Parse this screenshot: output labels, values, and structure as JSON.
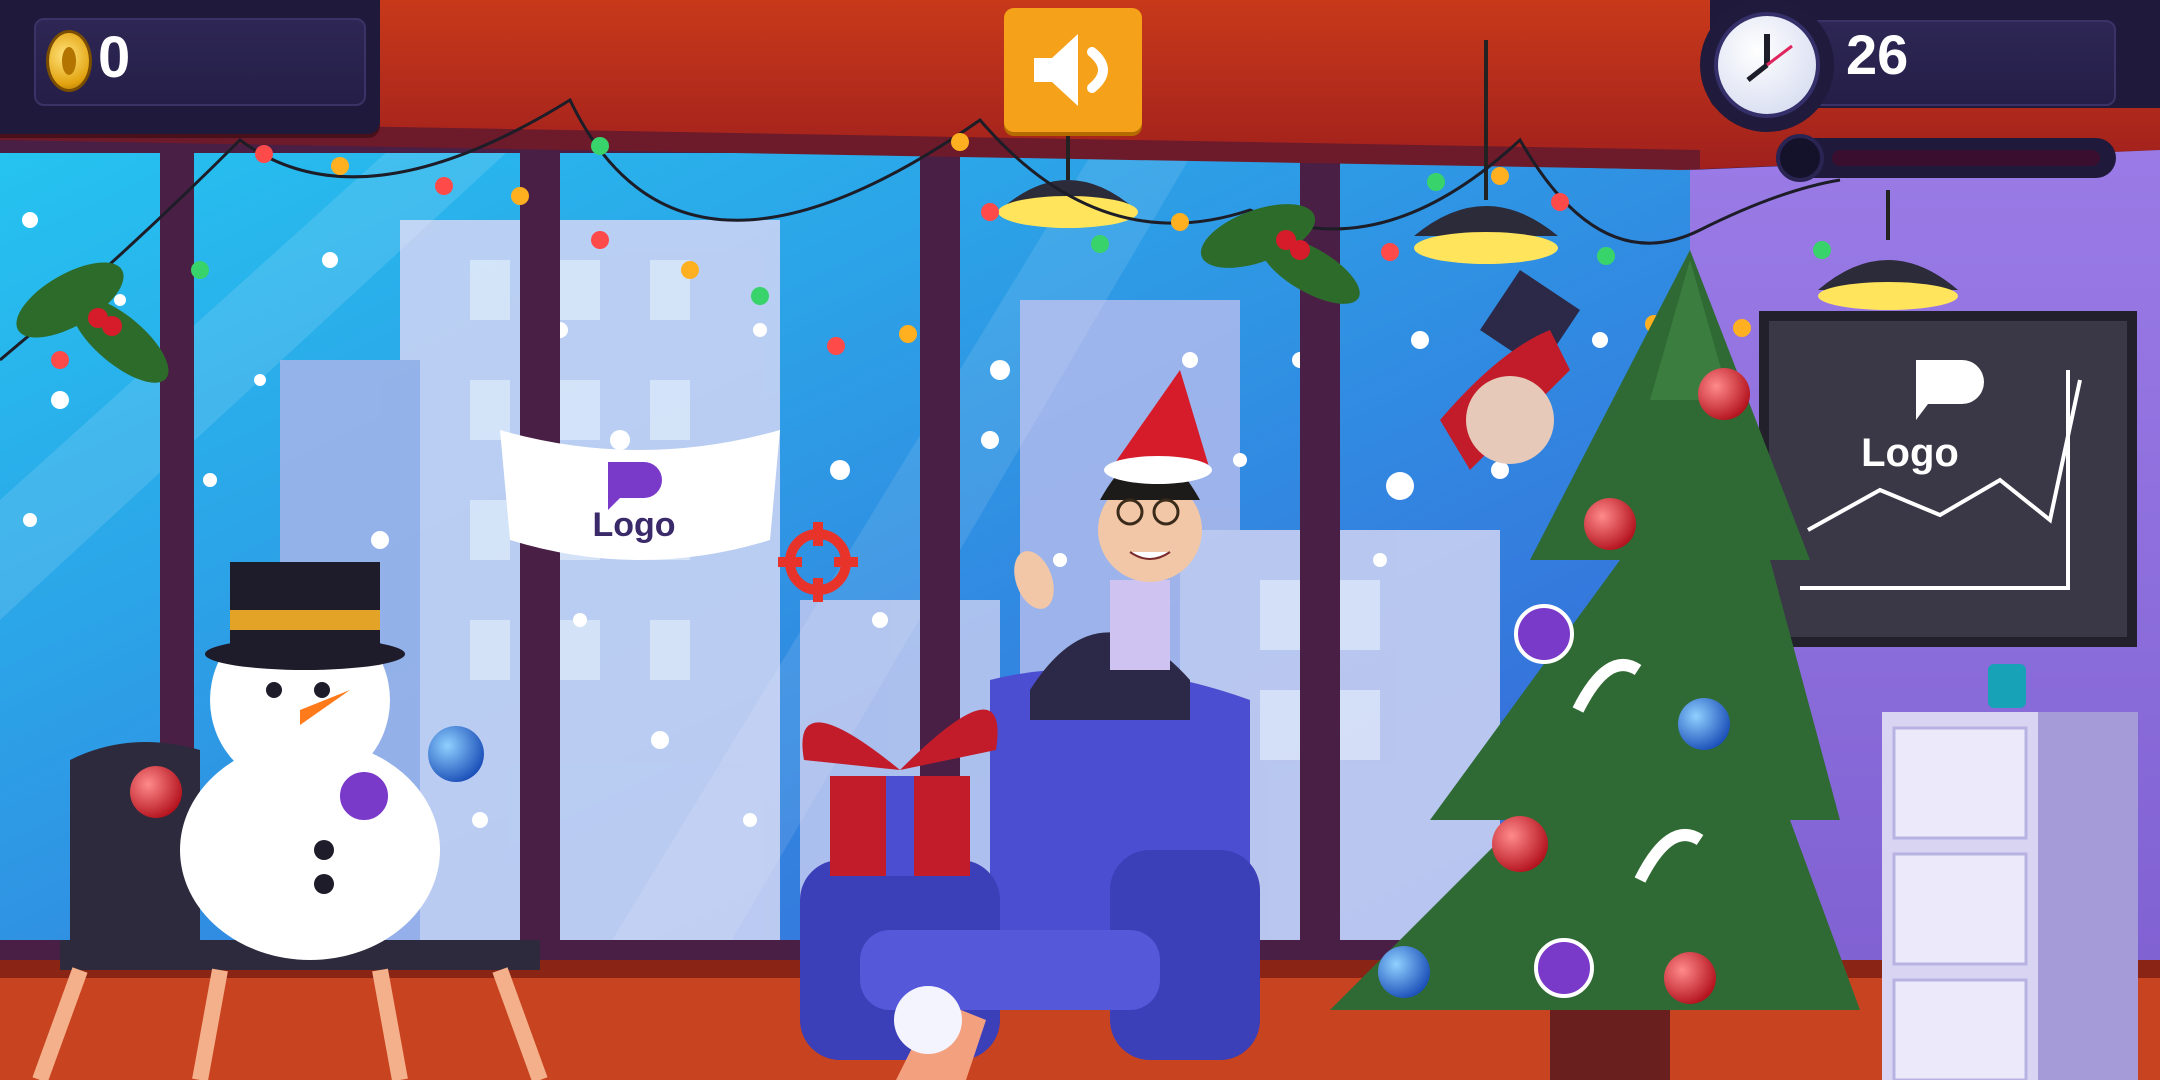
{
  "hud": {
    "coins": "0",
    "time_left": "26",
    "sound_icon": "speaker-icon",
    "timer_icon": "clock-icon",
    "coin_icon": "coin-icon",
    "progress_fraction": 0.0
  },
  "scene": {
    "banner_logo_text": "Logo",
    "board_logo_text": "Logo",
    "crosshair_icon": "crosshair-icon"
  },
  "colors": {
    "accent_sound": "#f5a21a",
    "hud_panel": "#1f1a3b",
    "crosshair": "#e8332a"
  }
}
